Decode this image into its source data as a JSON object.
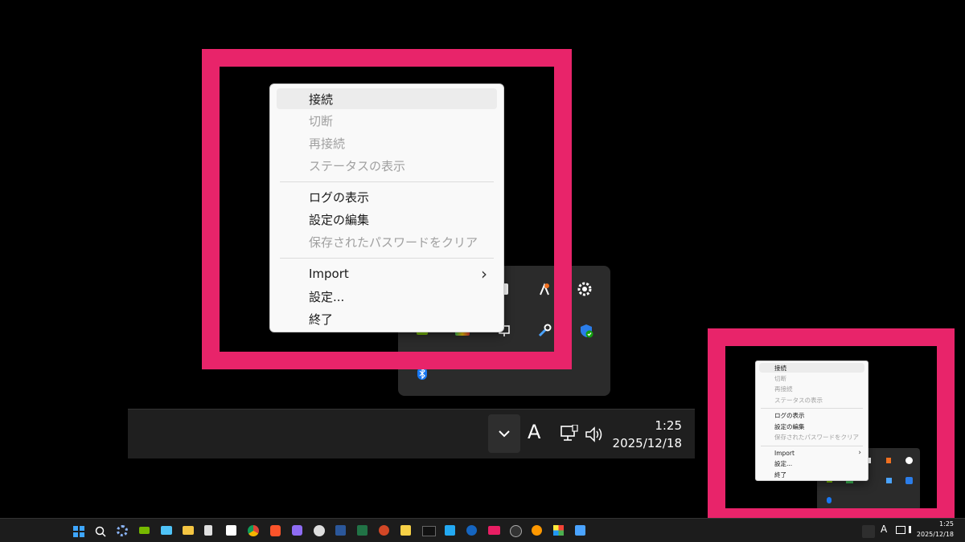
{
  "context_menu": {
    "items": [
      {
        "label": "接続",
        "enabled": true,
        "hover": true
      },
      {
        "label": "切断",
        "enabled": false
      },
      {
        "label": "再接続",
        "enabled": false
      },
      {
        "label": "ステータスの表示",
        "enabled": false
      },
      {
        "label": "ログの表示",
        "enabled": true
      },
      {
        "label": "設定の編集",
        "enabled": true
      },
      {
        "label": "保存されたパスワードをクリア",
        "enabled": false
      },
      {
        "label": "Import",
        "enabled": true,
        "submenu": true
      },
      {
        "label": "設定...",
        "enabled": true
      },
      {
        "label": "終了",
        "enabled": true
      }
    ],
    "submenu_arrow": "›"
  },
  "tray": {
    "keyboard_indicator": "A",
    "time": "1:25",
    "date": "2025/12/18",
    "chevron": "⌄"
  },
  "taskbar_small": {
    "time": "1:25",
    "date": "2025/12/18",
    "keyboard_indicator": "A",
    "apps": [
      "start-icon",
      "search-icon",
      "settings-icon",
      "nvidia-icon",
      "photos-icon",
      "file-explorer-icon",
      "openvpn-icon",
      "notion-icon",
      "chrome-icon",
      "brave-icon",
      "app-icon",
      "steam-icon",
      "word-icon",
      "excel-icon",
      "powerpoint-icon",
      "sticky-icon",
      "xm-icon",
      "vscode-icon",
      "app2-icon",
      "app3-icon",
      "obs-icon",
      "app4-icon",
      "app5-icon",
      "app6-icon"
    ]
  },
  "colors": {
    "highlight": "#e8246a",
    "menu_bg": "#f9f9f9",
    "flyout_bg": "#2b2b2b",
    "taskbar_bg": "#1f1f1f"
  }
}
